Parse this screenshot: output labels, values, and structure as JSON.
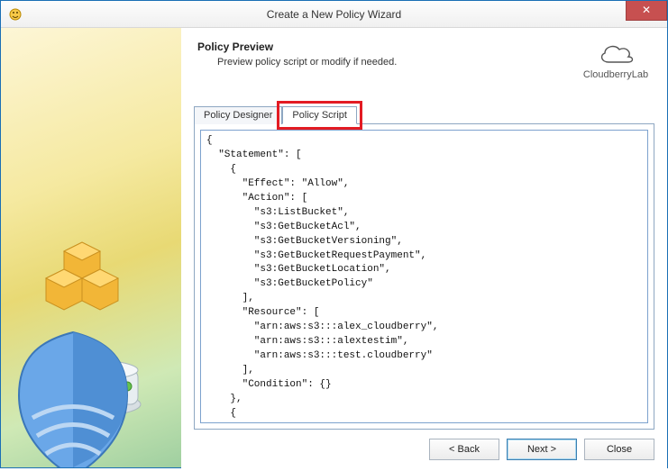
{
  "window": {
    "title": "Create a New Policy Wizard"
  },
  "header": {
    "title": "Policy Preview",
    "subtitle": "Preview policy script or modify if needed."
  },
  "brand": {
    "name": "CloudberryLab"
  },
  "tabs": {
    "designer": "Policy Designer",
    "script": "Policy Script",
    "active": "script"
  },
  "script_text": "{\n  \"Statement\": [\n    {\n      \"Effect\": \"Allow\",\n      \"Action\": [\n        \"s3:ListBucket\",\n        \"s3:GetBucketAcl\",\n        \"s3:GetBucketVersioning\",\n        \"s3:GetBucketRequestPayment\",\n        \"s3:GetBucketLocation\",\n        \"s3:GetBucketPolicy\"\n      ],\n      \"Resource\": [\n        \"arn:aws:s3:::alex_cloudberry\",\n        \"arn:aws:s3:::alextestim\",\n        \"arn:aws:s3:::test.cloudberry\"\n      ],\n      \"Condition\": {}\n    },\n    {\n      \"Effect\": \"Allow\",",
  "buttons": {
    "back": "< Back",
    "next": "Next >",
    "close": "Close"
  }
}
